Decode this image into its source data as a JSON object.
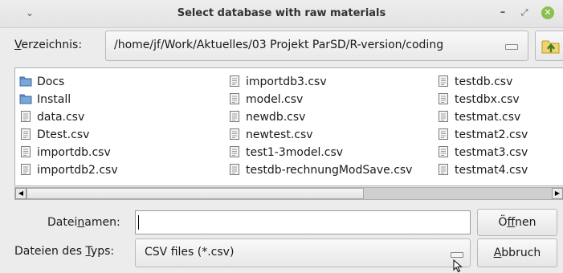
{
  "window": {
    "title": "Select database with raw materials",
    "menu_glyph": "⌄",
    "minimize_glyph": "–",
    "maximize_glyph": "⤢",
    "close_glyph": "✕"
  },
  "directory": {
    "label_underlined": "V",
    "label_rest": "erzeichnis:",
    "path": "/home/jf/Work/Aktuelles/03 Projekt ParSD/R-version/coding"
  },
  "files": {
    "column1": [
      {
        "name": "Docs",
        "type": "folder"
      },
      {
        "name": "Install",
        "type": "folder"
      },
      {
        "name": "data.csv",
        "type": "file"
      },
      {
        "name": "Dtest.csv",
        "type": "file"
      },
      {
        "name": "importdb.csv",
        "type": "file"
      },
      {
        "name": "importdb2.csv",
        "type": "file"
      }
    ],
    "column2": [
      {
        "name": "importdb3.csv",
        "type": "file"
      },
      {
        "name": "model.csv",
        "type": "file"
      },
      {
        "name": "newdb.csv",
        "type": "file"
      },
      {
        "name": "newtest.csv",
        "type": "file"
      },
      {
        "name": "test1-3model.csv",
        "type": "file"
      },
      {
        "name": "testdb-rechnungModSave.csv",
        "type": "file"
      }
    ],
    "column3": [
      {
        "name": "testdb.csv",
        "type": "file"
      },
      {
        "name": "testdbx.csv",
        "type": "file"
      },
      {
        "name": "testmat.csv",
        "type": "file"
      },
      {
        "name": "testmat2.csv",
        "type": "file"
      },
      {
        "name": "testmat3.csv",
        "type": "file"
      },
      {
        "name": "testmat4.csv",
        "type": "file"
      }
    ]
  },
  "filename": {
    "label_before": "Datei",
    "label_underlined": "n",
    "label_after": "amen:",
    "value": ""
  },
  "filetype": {
    "label_before": "Dateien des ",
    "label_underlined": "T",
    "label_after": "yps:",
    "selected": "CSV files (*.csv)"
  },
  "buttons": {
    "open_before": "Ö",
    "open_underlined": "f",
    "open_after": "fnen",
    "cancel_before": "",
    "cancel_underlined": "A",
    "cancel_after": "bbruch"
  },
  "colors": {
    "folder": "#5b8fc7",
    "accent_close": "#8bbf4f",
    "up_icon": "#6aa84f"
  },
  "icons": {
    "window_menu": "chevron-down-icon",
    "folder": "folder-icon",
    "file": "file-icon",
    "up": "folder-up-icon",
    "cursor": "mouse-cursor-icon"
  }
}
